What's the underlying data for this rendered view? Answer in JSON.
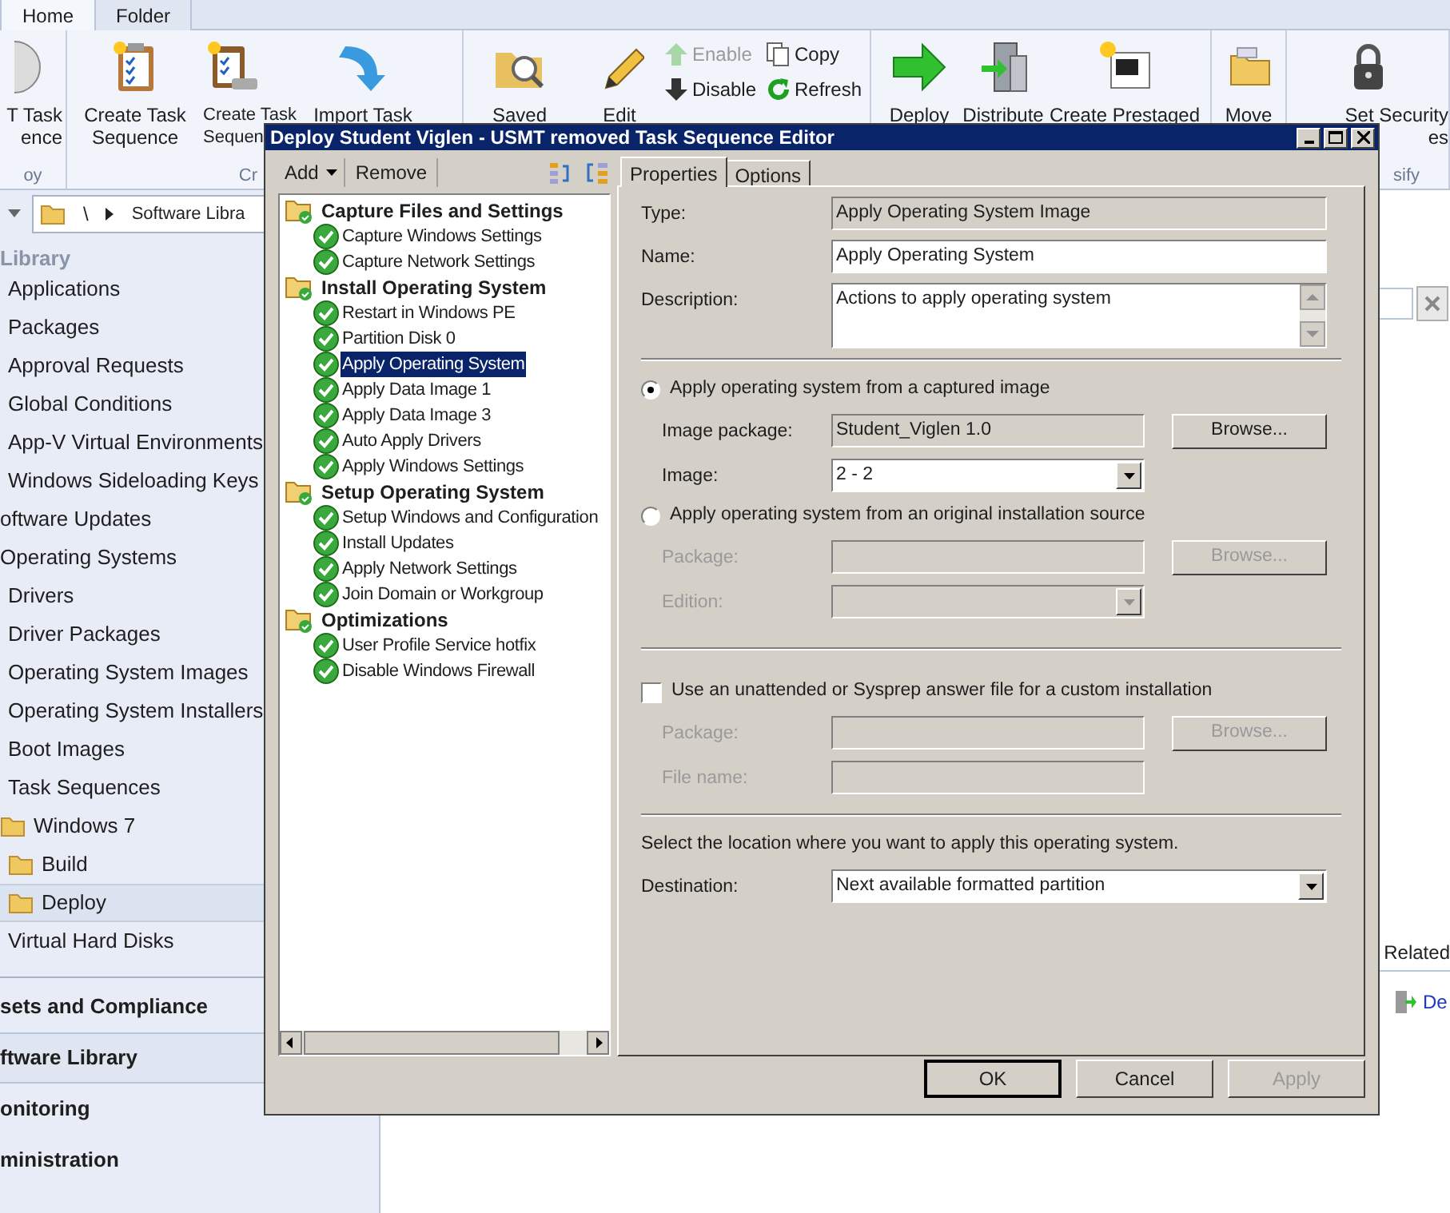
{
  "ribbon": {
    "tabs": [
      {
        "label": "Home",
        "selected": true
      },
      {
        "label": "Folder",
        "selected": false
      }
    ],
    "groups": [
      {
        "label": "oy",
        "items": [
          {
            "kind": "large",
            "lines": [
              "T Task",
              "ence"
            ]
          }
        ]
      },
      {
        "label": "Cr",
        "items": [
          {
            "kind": "large",
            "lines": [
              "Create Task",
              "Sequence"
            ]
          },
          {
            "kind": "large",
            "lines": [
              "Create Task",
              "Sequen"
            ]
          },
          {
            "kind": "large",
            "lines": [
              "Import Task"
            ]
          }
        ]
      },
      {
        "items": [
          {
            "kind": "large",
            "lines": [
              "Saved"
            ]
          },
          {
            "kind": "large",
            "lines": [
              "Edit"
            ]
          },
          {
            "kind": "small",
            "entries": [
              {
                "label": "Enable",
                "disabled": true
              },
              {
                "label": "Disable",
                "disabled": false
              }
            ]
          },
          {
            "kind": "small",
            "entries": [
              {
                "label": "Copy",
                "disabled": false
              },
              {
                "label": "Refresh",
                "disabled": false
              }
            ]
          }
        ]
      },
      {
        "items": [
          {
            "kind": "large",
            "lines": [
              "Deploy"
            ]
          },
          {
            "kind": "large",
            "lines": [
              "Distribute"
            ]
          },
          {
            "kind": "large",
            "lines": [
              "Create Prestaged"
            ]
          }
        ]
      },
      {
        "items": [
          {
            "kind": "large",
            "lines": [
              "Move"
            ]
          }
        ]
      },
      {
        "label": "sify",
        "items": [
          {
            "kind": "large",
            "lines": [
              "Set Security",
              "es"
            ]
          }
        ]
      }
    ]
  },
  "nav_bar": {
    "root": "\\",
    "location": "Software Libra"
  },
  "sidebar": {
    "header": "Library",
    "items": [
      {
        "children": [
          {
            "label": "Applications",
            "selected": false
          },
          {
            "label": "Packages",
            "selected": false
          },
          {
            "label": "Approval Requests",
            "selected": false
          },
          {
            "label": "Global Conditions",
            "selected": false
          },
          {
            "label": "App-V Virtual Environments",
            "selected": false
          },
          {
            "label": "Windows Sideloading Keys",
            "selected": false
          }
        ]
      },
      {
        "label": "oftware Updates",
        "selected": false
      },
      {
        "label": "Operating Systems",
        "selected": false,
        "children": [
          {
            "label": "Drivers",
            "selected": false
          },
          {
            "label": "Driver Packages",
            "selected": false
          },
          {
            "label": "Operating System Images",
            "selected": false
          },
          {
            "label": "Operating System Installers",
            "selected": false
          },
          {
            "label": "Boot Images",
            "selected": false
          },
          {
            "label": "Task Sequences",
            "selected": false,
            "children": [
              {
                "label": "Windows 7",
                "selected": false,
                "children": [
                  {
                    "label": "Build",
                    "selected": false
                  },
                  {
                    "label": "Deploy",
                    "selected": true
                  }
                ]
              }
            ]
          },
          {
            "label": "Virtual Hard Disks",
            "selected": false
          }
        ]
      }
    ],
    "workspaces": [
      {
        "label": "sets and Compliance",
        "selected": false
      },
      {
        "label": "ftware Library",
        "selected": true
      },
      {
        "label": "onitoring",
        "selected": false
      },
      {
        "label": "ministration",
        "selected": false
      }
    ]
  },
  "main": {
    "related_heading": "Related",
    "related_link": "De"
  },
  "dialog": {
    "title": "Deploy Student Viglen - USMT removed Task Sequence Editor",
    "toolbar": {
      "add": "Add",
      "remove": "Remove"
    },
    "tree": [
      {
        "label": "Capture Files and Settings",
        "selected": false,
        "children": [
          {
            "label": "Capture Windows Settings",
            "selected": false
          },
          {
            "label": "Capture Network Settings",
            "selected": false
          }
        ]
      },
      {
        "label": "Install Operating System",
        "selected": false,
        "children": [
          {
            "label": "Restart in Windows PE",
            "selected": false
          },
          {
            "label": "Partition Disk 0",
            "selected": false
          },
          {
            "label": "Apply Operating System",
            "selected": true
          },
          {
            "label": "Apply Data Image 1",
            "selected": false
          },
          {
            "label": "Apply Data Image 3",
            "selected": false
          },
          {
            "label": "Auto Apply Drivers",
            "selected": false
          },
          {
            "label": "Apply Windows Settings",
            "selected": false
          }
        ]
      },
      {
        "label": "Setup Operating System",
        "selected": false,
        "children": [
          {
            "label": "Setup Windows and Configuration",
            "selected": false
          },
          {
            "label": "Install Updates",
            "selected": false
          },
          {
            "label": "Apply Network Settings",
            "selected": false
          },
          {
            "label": "Join Domain or Workgroup",
            "selected": false
          }
        ]
      },
      {
        "label": "Optimizations",
        "selected": false,
        "children": [
          {
            "label": "User Profile Service hotfix",
            "selected": false
          },
          {
            "label": "Disable Windows Firewall",
            "selected": false
          }
        ]
      }
    ],
    "tabs": [
      {
        "label": "Properties",
        "selected": true
      },
      {
        "label": "Options",
        "selected": false
      }
    ],
    "sections": [
      {
        "rows": [
          {
            "kind": "readonly",
            "label": "Type:",
            "value": "Apply Operating System Image"
          },
          {
            "kind": "text",
            "label": "Name:",
            "value": "Apply Operating System",
            "disabled": false
          },
          {
            "kind": "textarea",
            "label": "Description:",
            "value": "Actions to apply operating system"
          }
        ]
      },
      {
        "rows": [
          {
            "kind": "radio",
            "label": "Apply operating system from a captured image",
            "selected": true,
            "children": [
              {
                "kind": "readonly",
                "label": "Image package:",
                "value": "Student_Viglen 1.0",
                "button": {
                  "label": "Browse...",
                  "disabled": false
                }
              },
              {
                "kind": "select",
                "label": "Image:",
                "value": "2 - 2",
                "disabled": false
              }
            ]
          },
          {
            "kind": "radio",
            "label": "Apply operating system from an original installation source",
            "selected": false,
            "children": [
              {
                "kind": "text",
                "label": "Package:",
                "disabled": true,
                "button": {
                  "label": "Browse...",
                  "disabled": true
                }
              },
              {
                "kind": "select",
                "label": "Edition:",
                "disabled": true
              }
            ]
          }
        ]
      },
      {
        "rows": [
          {
            "kind": "checkbox",
            "label": "Use an unattended or Sysprep answer file for a custom installation",
            "checked": false,
            "children": [
              {
                "kind": "text",
                "label": "Package:",
                "disabled": true,
                "button": {
                  "label": "Browse...",
                  "disabled": true
                }
              },
              {
                "kind": "text",
                "label": "File name:",
                "disabled": true
              }
            ]
          }
        ]
      },
      {
        "rows": [
          {
            "kind": "note",
            "label": "Select the location where you want to apply this operating system."
          },
          {
            "kind": "select",
            "label": "Destination:",
            "value": "Next available formatted partition",
            "disabled": false
          }
        ]
      }
    ],
    "buttons": [
      {
        "label": "OK",
        "default": true,
        "disabled": false
      },
      {
        "label": "Cancel",
        "default": false,
        "disabled": false
      },
      {
        "label": "Apply",
        "default": false,
        "disabled": true
      }
    ]
  }
}
